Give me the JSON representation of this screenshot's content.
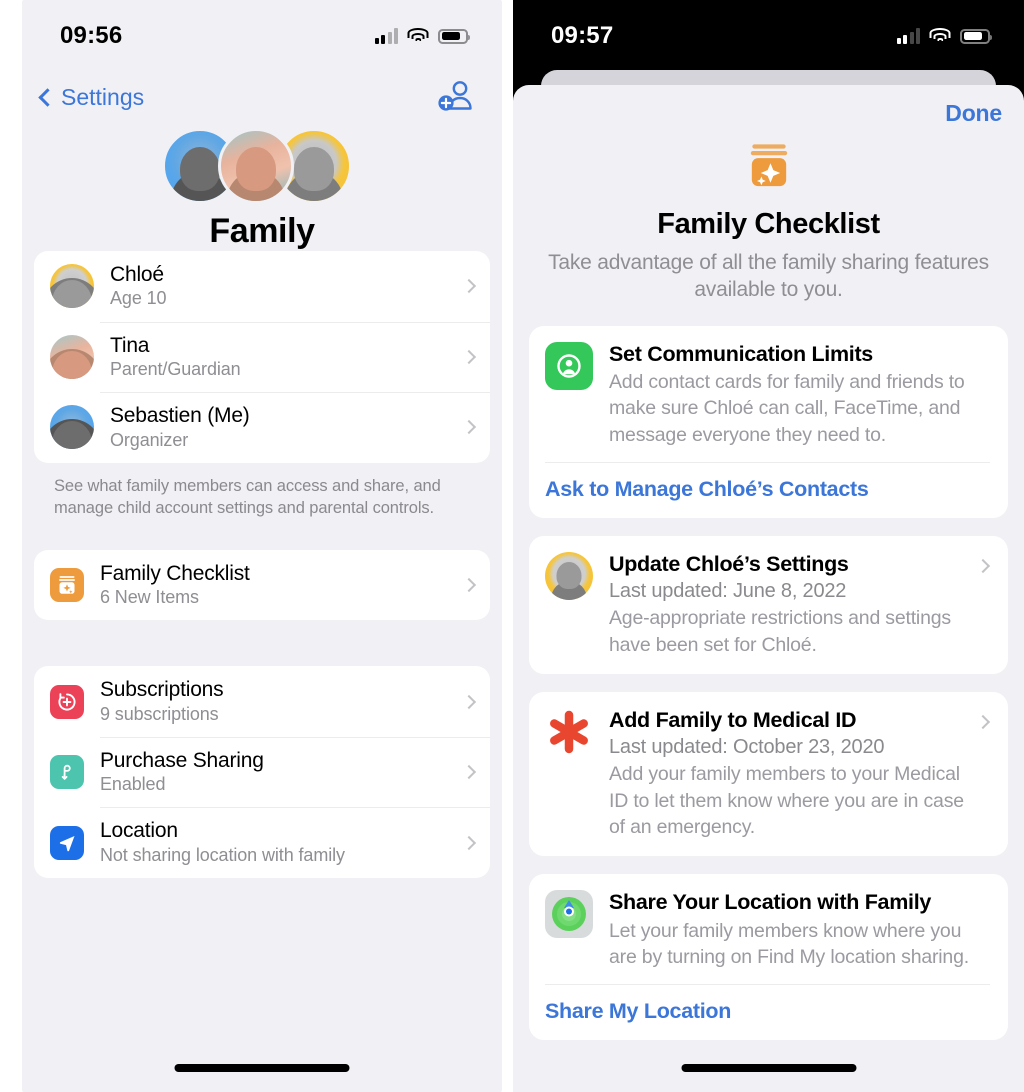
{
  "left_screen": {
    "status_bar": {
      "time": "09:56",
      "signal_icon": "cellular-bars-icon",
      "wifi_icon": "wifi-icon",
      "battery_icon": "battery-icon"
    },
    "nav": {
      "back_label": "Settings",
      "back_icon": "chevron-left-icon",
      "add_member_icon": "add-person-icon"
    },
    "header": {
      "title": "Family",
      "avatars": [
        "sebastien-avatar",
        "tina-avatar",
        "chloe-avatar"
      ]
    },
    "members": [
      {
        "name": "Chloé",
        "role": "Age 10",
        "avatar": "chloe-avatar"
      },
      {
        "name": "Tina",
        "role": "Parent/Guardian",
        "avatar": "tina-avatar"
      },
      {
        "name": "Sebastien (Me)",
        "role": "Organizer",
        "avatar": "sebastien-avatar"
      }
    ],
    "members_footnote": "See what family members can access and share, and manage child account settings and parental controls.",
    "checklist_row": {
      "title": "Family Checklist",
      "subtitle": "6 New Items",
      "icon": "family-checklist-jar-icon",
      "icon_color": "#ED9B3C"
    },
    "settings_rows": [
      {
        "title": "Subscriptions",
        "subtitle": "9 subscriptions",
        "icon": "subscriptions-icon",
        "icon_color": "#EB4257"
      },
      {
        "title": "Purchase Sharing",
        "subtitle": "Enabled",
        "icon": "purchase-sharing-icon",
        "icon_color": "#4CC4AE"
      },
      {
        "title": "Location",
        "subtitle": "Not sharing location with family",
        "icon": "location-arrow-icon",
        "icon_color": "#1D6FE8"
      }
    ]
  },
  "right_screen": {
    "status_bar": {
      "time": "09:57",
      "signal_icon": "cellular-bars-icon",
      "wifi_icon": "wifi-icon",
      "battery_icon": "battery-icon"
    },
    "sheet": {
      "done_label": "Done",
      "hero_icon": "family-checklist-jar-icon",
      "hero_icon_color": "#ED9B3C",
      "title": "Family Checklist",
      "subtitle": "Take advantage of all the family sharing features available to you."
    },
    "checklist_items": [
      {
        "title": "Set Communication Limits",
        "meta": "",
        "description": "Add contact cards for family and friends to make sure Chloé can call, FaceTime, and message everyone they need to.",
        "action": "Ask to Manage Chloé’s Contacts",
        "icon": "contacts-person-icon",
        "icon_color": "#34C759",
        "has_chevron": false
      },
      {
        "title": "Update Chloé’s Settings",
        "meta": "Last updated: June 8, 2022",
        "description": "Age-appropriate restrictions and settings have been set for Chloé.",
        "action": "",
        "icon": "chloe-avatar",
        "icon_color": "#F5C03A",
        "has_chevron": true
      },
      {
        "title": "Add Family to Medical ID",
        "meta": "Last updated: October 23, 2020",
        "description": "Add your family members to your Medical ID to let them know where you are in case of an emergency.",
        "action": "",
        "icon": "medical-id-asterisk-icon",
        "icon_color": "#E8462F",
        "has_chevron": true
      },
      {
        "title": "Share Your Location with Family",
        "meta": "",
        "description": "Let your family members know where you are by turning on Find My location sharing.",
        "action": "Share My Location",
        "icon": "find-my-icon",
        "icon_color": "#5BD15B",
        "has_chevron": false
      }
    ]
  }
}
